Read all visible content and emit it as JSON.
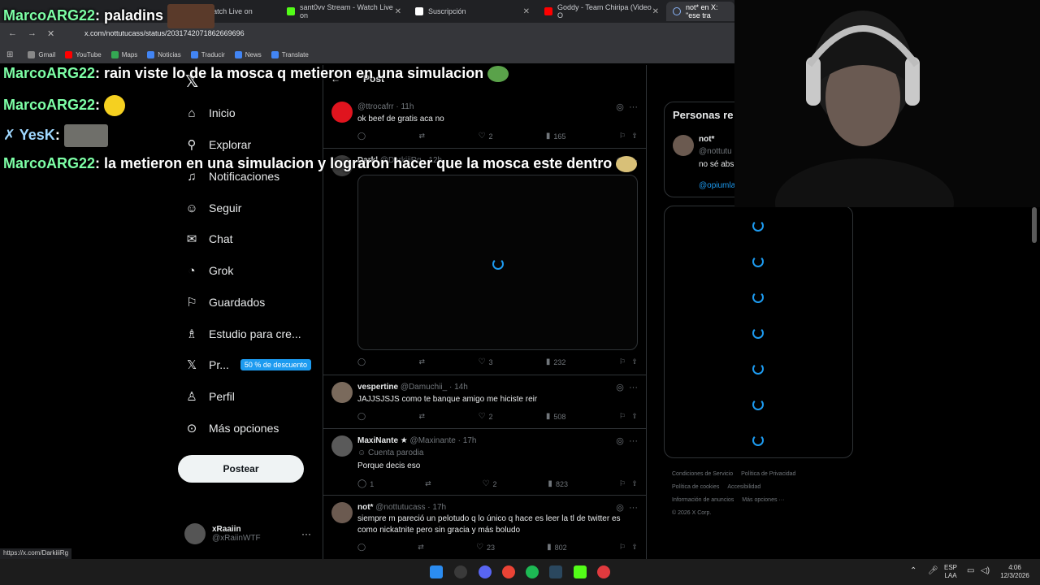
{
  "browser": {
    "tabs": [
      {
        "label": "Watch Live on",
        "color": "#53fc18"
      },
      {
        "label": "sant0vv Stream - Watch Live on",
        "color": "#53fc18"
      },
      {
        "label": "Suscripción",
        "color": "#ffffff"
      },
      {
        "label": "Goddy - Team Chiripa (Video O",
        "color": "#ff0000"
      },
      {
        "label": "not* en X: \"ese tra",
        "color": "#8ab4f8"
      }
    ],
    "url": "x.com/nottutucass/status/2031742071862669696",
    "bookmarks": [
      "Gmail",
      "YouTube",
      "Maps",
      "Noticias",
      "Traducir",
      "News",
      "Translate"
    ],
    "status_url": "https://x.com/DarkiiiRg"
  },
  "chat": [
    {
      "user": "MarcoARG22",
      "message": ": paladins"
    },
    {
      "user": "MarcoARG22",
      "message": ": rain viste lo de la mosca q metieron en una simulacion"
    },
    {
      "user": "MarcoARG22",
      "message": ":"
    },
    {
      "user": "YesK",
      "message": ":"
    },
    {
      "user": "MarcoARG22",
      "message": ": la metieron en una simulacion y lograron hacer que la mosca este dentro"
    }
  ],
  "nav": {
    "items": [
      "Inicio",
      "Explorar",
      "Notificaciones",
      "Seguir",
      "Chat",
      "Grok",
      "Guardados",
      "Estudio para cre...",
      "Pr...",
      "Perfil",
      "Más opciones"
    ],
    "premium_badge": "50 % de descuento",
    "post_button": "Postear",
    "account": {
      "name": "xRaaiin",
      "handle": "@xRaiinWTF"
    }
  },
  "header": {
    "title": "Post"
  },
  "tweets": [
    {
      "name": "",
      "handle": "@ttrocafrr · 11h",
      "text": "ok beef de gratis aca no",
      "replies": "",
      "retweets": "",
      "likes": "2",
      "views": "165",
      "avatar_color": "#e0141e"
    },
    {
      "name": "Darkl",
      "handle": "@DarkiiiRg · 12h",
      "text": "",
      "replies": "",
      "retweets": "",
      "likes": "3",
      "views": "232",
      "avatar_color": "#3a3a3a"
    },
    {
      "name": "vespertine",
      "handle": "@Damuchii_ · 14h",
      "text": "JAJJSJSJS como te banque amigo me hiciste reir",
      "replies": "",
      "retweets": "",
      "likes": "2",
      "views": "508",
      "avatar_color": "#7a6a5c"
    },
    {
      "name": "MaxiNante ★",
      "handle": "@Maxinante · 17h",
      "text": "Porque decis eso",
      "sub": "Cuenta parodia",
      "replies": "1",
      "retweets": "",
      "likes": "2",
      "views": "823",
      "avatar_color": "#5a5a5a"
    },
    {
      "name": "not*",
      "handle": "@nottutucass · 17h",
      "text": "siempre m pareció un pelotudo q lo único q hace es leer la tl de twitter es como nickatnite pero sin gracia y más boludo",
      "replies": "",
      "retweets": "",
      "likes": "23",
      "views": "802",
      "avatar_color": "#6b5a50"
    }
  ],
  "right": {
    "who_title": "Personas re",
    "who_name": "not*",
    "who_handle": "@nottutu",
    "who_bio": "no sé abs de los ten",
    "who_link": "@opiumla",
    "footer": [
      "Condiciones de Servicio",
      "Política de Privacidad",
      "Política de cookies",
      "Accesibilidad",
      "Información de anuncios",
      "Más opciones ···",
      "© 2026 X Corp."
    ]
  },
  "taskbar": {
    "lang": "ESP\nLAA",
    "time": "4:06",
    "date": "12/3/2026",
    "icon_colors": [
      "#2b8cf0",
      "#3a3a3a",
      "#5865f2",
      "#ea4335",
      "#1db954",
      "#2a475e",
      "#53fc18",
      "#e03a3e"
    ]
  }
}
